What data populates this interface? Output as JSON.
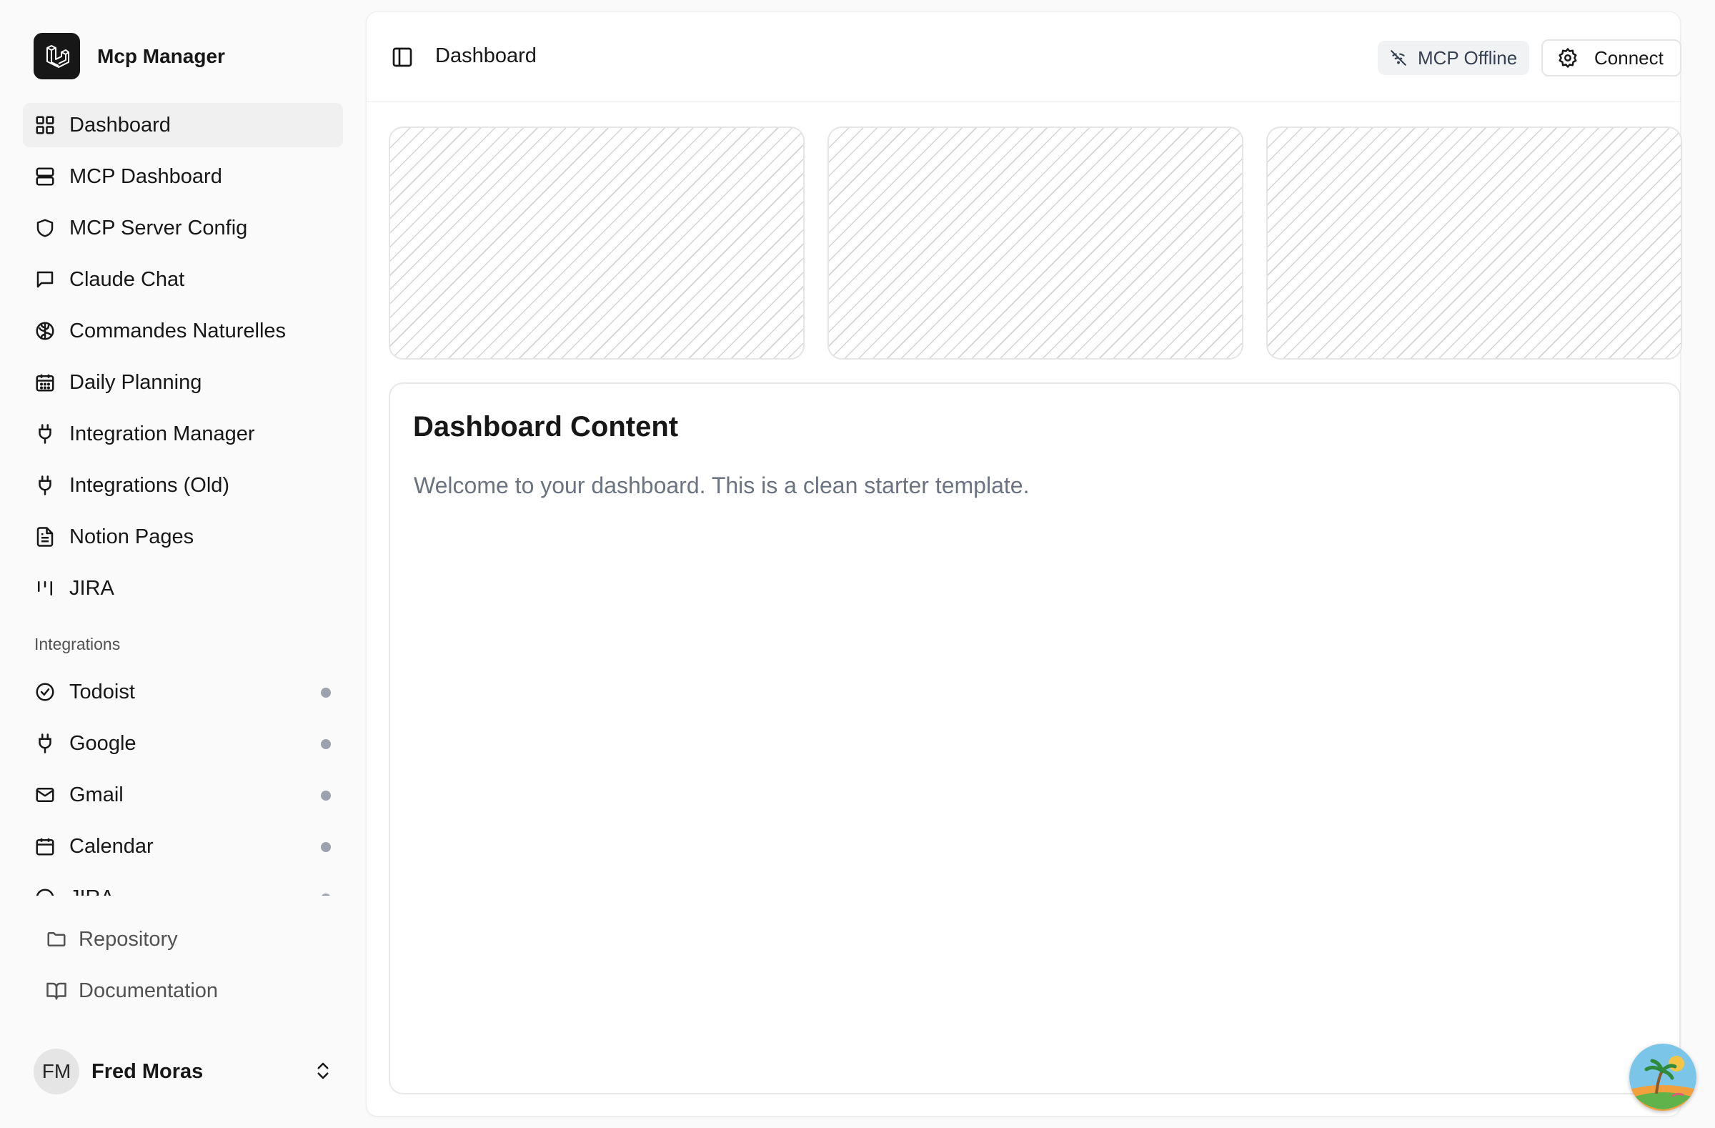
{
  "app": {
    "name": "Mcp Manager"
  },
  "sidebar": {
    "nav": [
      {
        "label": "Dashboard",
        "icon": "layout-grid-icon",
        "active": true
      },
      {
        "label": "MCP Dashboard",
        "icon": "server-icon"
      },
      {
        "label": "MCP Server Config",
        "icon": "shield-icon"
      },
      {
        "label": "Claude Chat",
        "icon": "message-square-icon"
      },
      {
        "label": "Commandes Naturelles",
        "icon": "brain-icon"
      },
      {
        "label": "Daily Planning",
        "icon": "calendar-days-icon"
      },
      {
        "label": "Integration Manager",
        "icon": "plug-icon"
      },
      {
        "label": "Integrations (Old)",
        "icon": "plug-icon"
      },
      {
        "label": "Notion Pages",
        "icon": "file-text-icon"
      },
      {
        "label": "JIRA",
        "icon": "kanban-icon"
      }
    ],
    "integrations_label": "Integrations",
    "integrations": [
      {
        "label": "Todoist",
        "icon": "circle-check-icon",
        "status_color": "#9ca3af"
      },
      {
        "label": "Google",
        "icon": "plug-icon",
        "status_color": "#9ca3af"
      },
      {
        "label": "Gmail",
        "icon": "mail-icon",
        "status_color": "#9ca3af"
      },
      {
        "label": "Calendar",
        "icon": "calendar-icon",
        "status_color": "#9ca3af"
      },
      {
        "label": "JIRA",
        "icon": "circle-icon",
        "status_color": "#9ca3af"
      }
    ],
    "footer": [
      {
        "label": "Repository",
        "icon": "folder-icon"
      },
      {
        "label": "Documentation",
        "icon": "book-open-icon"
      }
    ],
    "user": {
      "initials": "FM",
      "name": "Fred Moras"
    }
  },
  "header": {
    "title": "Dashboard",
    "status": "MCP Offline",
    "connect_label": "Connect"
  },
  "content": {
    "title": "Dashboard Content",
    "text": "Welcome to your dashboard. This is a clean starter template."
  }
}
